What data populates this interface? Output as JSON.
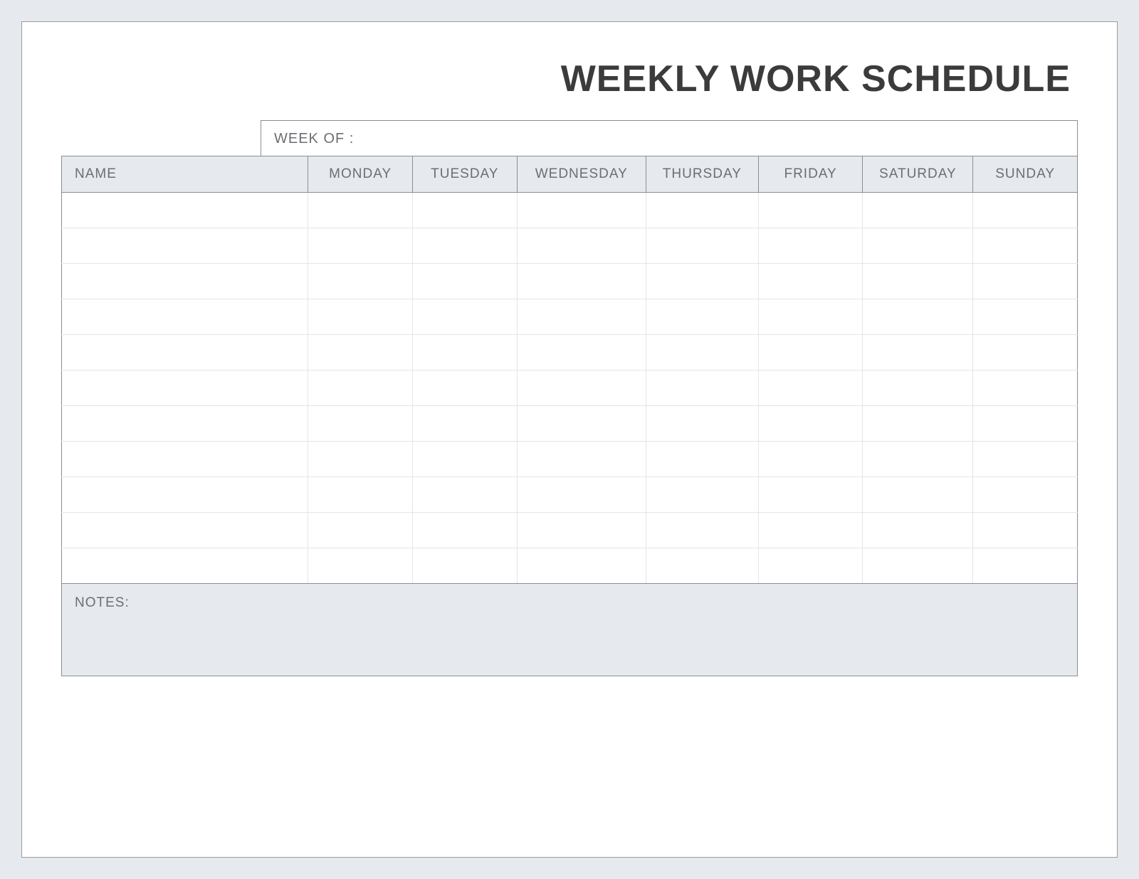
{
  "title": "WEEKLY WORK SCHEDULE",
  "week_of_label": "WEEK OF :",
  "week_of_value": "",
  "table": {
    "name_header": "NAME",
    "day_headers": [
      "MONDAY",
      "TUESDAY",
      "WEDNESDAY",
      "THURSDAY",
      "FRIDAY",
      "SATURDAY",
      "SUNDAY"
    ],
    "rows": [
      {
        "name": "",
        "days": [
          "",
          "",
          "",
          "",
          "",
          "",
          ""
        ]
      },
      {
        "name": "",
        "days": [
          "",
          "",
          "",
          "",
          "",
          "",
          ""
        ]
      },
      {
        "name": "",
        "days": [
          "",
          "",
          "",
          "",
          "",
          "",
          ""
        ]
      },
      {
        "name": "",
        "days": [
          "",
          "",
          "",
          "",
          "",
          "",
          ""
        ]
      },
      {
        "name": "",
        "days": [
          "",
          "",
          "",
          "",
          "",
          "",
          ""
        ]
      },
      {
        "name": "",
        "days": [
          "",
          "",
          "",
          "",
          "",
          "",
          ""
        ]
      },
      {
        "name": "",
        "days": [
          "",
          "",
          "",
          "",
          "",
          "",
          ""
        ]
      },
      {
        "name": "",
        "days": [
          "",
          "",
          "",
          "",
          "",
          "",
          ""
        ]
      },
      {
        "name": "",
        "days": [
          "",
          "",
          "",
          "",
          "",
          "",
          ""
        ]
      },
      {
        "name": "",
        "days": [
          "",
          "",
          "",
          "",
          "",
          "",
          ""
        ]
      },
      {
        "name": "",
        "days": [
          "",
          "",
          "",
          "",
          "",
          "",
          ""
        ]
      }
    ]
  },
  "notes_label": "NOTES:",
  "notes_value": ""
}
